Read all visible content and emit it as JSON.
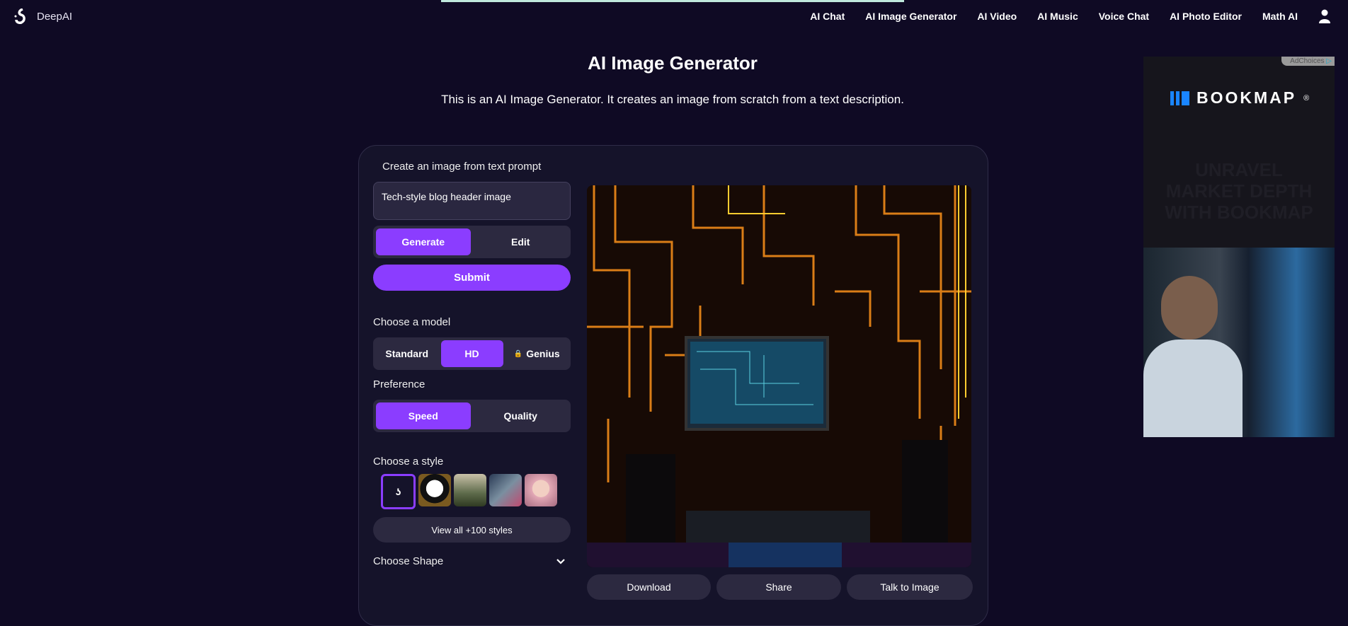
{
  "nav": {
    "brand": "DeepAI",
    "items": [
      "AI Chat",
      "AI Image Generator",
      "AI Video",
      "AI Music",
      "Voice Chat",
      "AI Photo Editor",
      "Math AI"
    ]
  },
  "page": {
    "title": "AI Image Generator",
    "subtitle": "This is an AI Image Generator. It creates an image from scratch from a text description."
  },
  "form": {
    "heading": "Create an image from text prompt",
    "prompt": "Tech-style blog header image",
    "modes": [
      "Generate",
      "Edit"
    ],
    "submit": "Submit",
    "model_label": "Choose a model",
    "models": [
      "Standard",
      "HD",
      "Genius"
    ],
    "pref_label": "Preference",
    "prefs": [
      "Speed",
      "Quality"
    ],
    "style_label": "Choose a style",
    "view_all": "View all +100 styles",
    "shape_label": "Choose Shape"
  },
  "actions": [
    "Download",
    "Share",
    "Talk to Image"
  ],
  "ad": {
    "adchoices": "AdChoices",
    "brand": "BOOKMAP",
    "tagline": "UNRAVEL MARKET DEPTH WITH BOOKMAP"
  },
  "colors": {
    "accent": "#8b3dff",
    "bg": "#0f0a24"
  }
}
